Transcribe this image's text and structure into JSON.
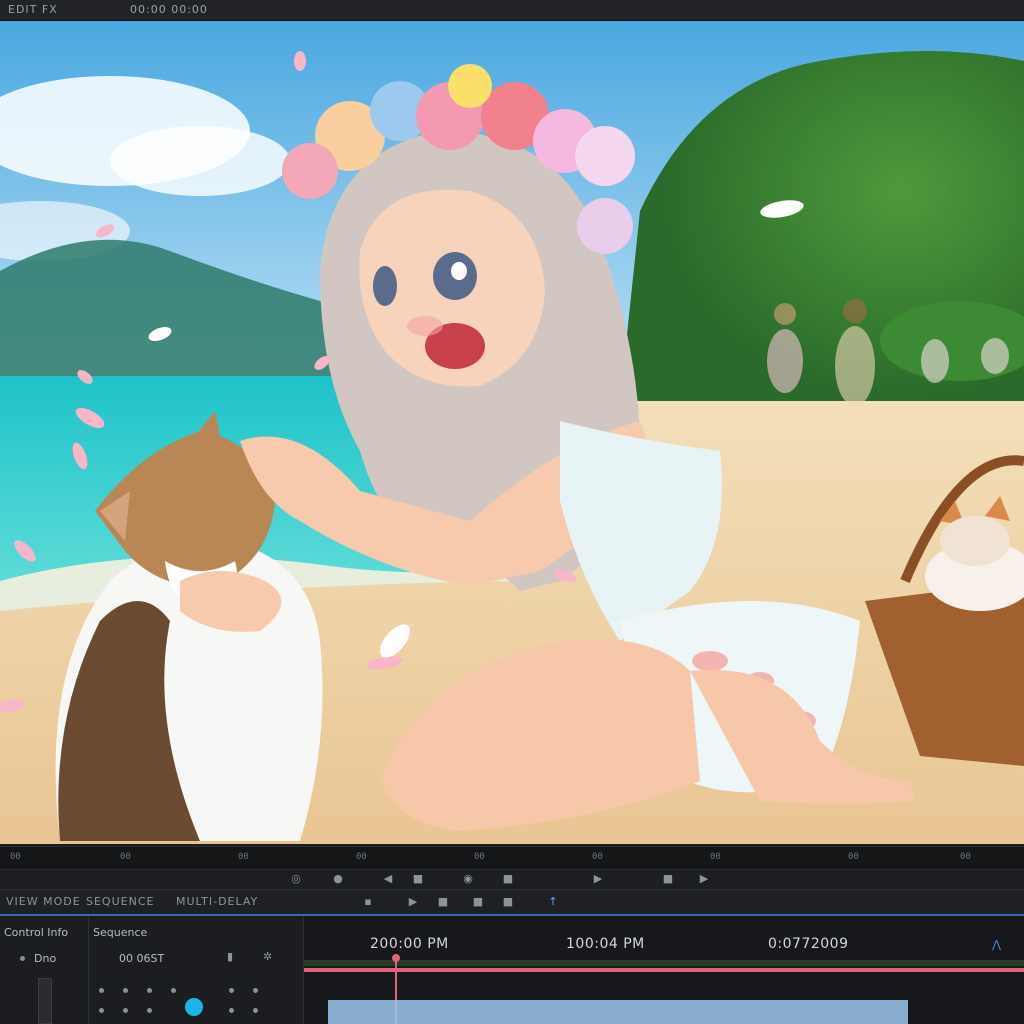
{
  "topbar": {
    "left_text": "EDIT FX",
    "mid_text": "00:00 00:00"
  },
  "ruler": {
    "ticks": [
      "00",
      "00",
      "00",
      "00",
      "00",
      "00",
      "00",
      "00",
      "00"
    ]
  },
  "transport": {
    "play_icon": "play-icon",
    "back_icon": "step-back-icon",
    "marker_icon": "marker-icon"
  },
  "tabs": [
    "VIEW MODE",
    "SEQUENCE",
    "MULTI-DELAY"
  ],
  "left_panel": {
    "title": "Control Info",
    "value": "Dno"
  },
  "mid_panel": {
    "title": "Sequence",
    "value": "00 06ST"
  },
  "timeline": {
    "timecodes": [
      "200:00 PM",
      "100:04 PM",
      "0:0772009"
    ],
    "playhead_color": "#e0637a",
    "accent_color": "#2f6db3",
    "clip_color": "#9cc8ef"
  }
}
